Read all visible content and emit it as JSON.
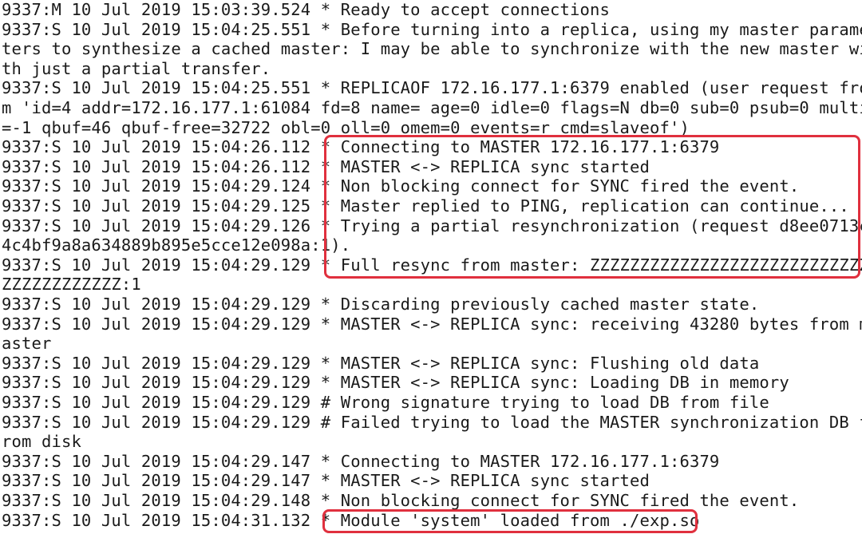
{
  "terminal": {
    "lines": [
      "9337:M 10 Jul 2019 15:03:39.524 * Ready to accept connections",
      "9337:S 10 Jul 2019 15:04:25.551 * Before turning into a replica, using my master parame",
      "ters to synthesize a cached master: I may be able to synchronize with the new master wi",
      "th just a partial transfer.",
      "9337:S 10 Jul 2019 15:04:25.551 * REPLICAOF 172.16.177.1:6379 enabled (user request fro",
      "m 'id=4 addr=172.16.177.1:61084 fd=8 name= age=0 idle=0 flags=N db=0 sub=0 psub=0 multi",
      "=-1 qbuf=46 qbuf-free=32722 obl=0 oll=0 omem=0 events=r cmd=slaveof')",
      "9337:S 10 Jul 2019 15:04:26.112 * Connecting to MASTER 172.16.177.1:6379",
      "9337:S 10 Jul 2019 15:04:26.112 * MASTER <-> REPLICA sync started",
      "9337:S 10 Jul 2019 15:04:29.124 * Non blocking connect for SYNC fired the event.",
      "9337:S 10 Jul 2019 15:04:29.125 * Master replied to PING, replication can continue...",
      "9337:S 10 Jul 2019 15:04:29.126 * Trying a partial resynchronization (request d8ee0713c",
      "4c4bf9a8a634889b895e5cce12e098a:1).",
      "9337:S 10 Jul 2019 15:04:29.129 * Full resync from master: ZZZZZZZZZZZZZZZZZZZZZZZZZZZZ",
      "ZZZZZZZZZZZZ:1",
      "9337:S 10 Jul 2019 15:04:29.129 * Discarding previously cached master state.",
      "9337:S 10 Jul 2019 15:04:29.129 * MASTER <-> REPLICA sync: receiving 43280 bytes from m",
      "aster",
      "9337:S 10 Jul 2019 15:04:29.129 * MASTER <-> REPLICA sync: Flushing old data",
      "9337:S 10 Jul 2019 15:04:29.129 * MASTER <-> REPLICA sync: Loading DB in memory",
      "9337:S 10 Jul 2019 15:04:29.129 # Wrong signature trying to load DB from file",
      "9337:S 10 Jul 2019 15:04:29.129 # Failed trying to load the MASTER synchronization DB f",
      "rom disk",
      "9337:S 10 Jul 2019 15:04:29.147 * Connecting to MASTER 172.16.177.1:6379",
      "9337:S 10 Jul 2019 15:04:29.147 * MASTER <-> REPLICA sync started",
      "9337:S 10 Jul 2019 15:04:29.148 * Non blocking connect for SYNC fired the event.",
      "9337:S 10 Jul 2019 15:04:31.132 * Module 'system' loaded from ./exp.so"
    ]
  },
  "highlight_color": "#e0303e",
  "text_color": "#1a1a1a",
  "background_color": "#ffffff"
}
